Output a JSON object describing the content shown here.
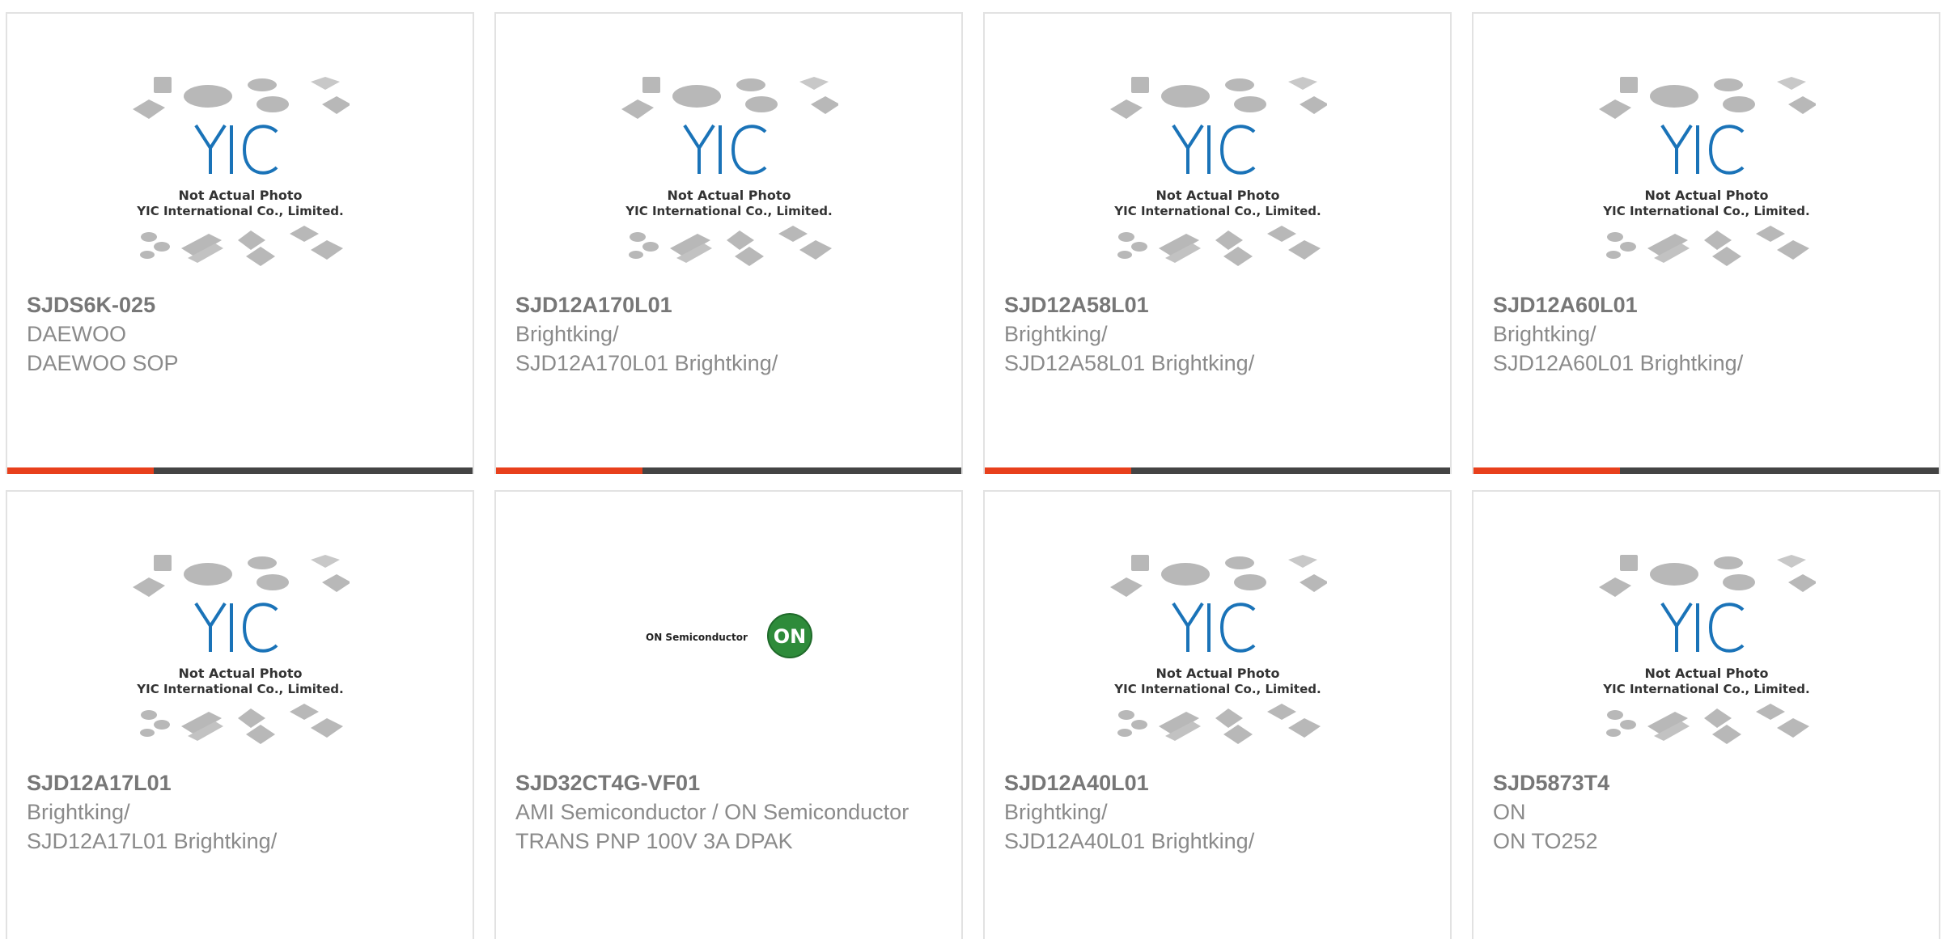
{
  "placeholder_image": {
    "caption_line1": "Not Actual Photo",
    "caption_line2": "YIC International Co., Limited.",
    "logo_text": "YIC"
  },
  "on_logo": {
    "text": "ON Semiconductor",
    "badge": "ON"
  },
  "colors": {
    "accent_red": "#e8401c",
    "accent_dark": "#444444",
    "yic_blue": "#1a73b8",
    "on_green": "#2e8b3a"
  },
  "products": [
    {
      "part_no": "SJDS6K-025",
      "manufacturer": "DAEWOO",
      "description": "DAEWOO SOP"
    },
    {
      "part_no": "SJD12A170L01",
      "manufacturer": "Brightking/",
      "description": "SJD12A170L01 Brightking/"
    },
    {
      "part_no": "SJD12A58L01",
      "manufacturer": "Brightking/",
      "description": "SJD12A58L01 Brightking/"
    },
    {
      "part_no": "SJD12A60L01",
      "manufacturer": "Brightking/",
      "description": "SJD12A60L01 Brightking/"
    },
    {
      "part_no": "SJD12A17L01",
      "manufacturer": "Brightking/",
      "description": "SJD12A17L01 Brightking/"
    },
    {
      "part_no": "SJD32CT4G-VF01",
      "manufacturer": "AMI Semiconductor / ON Semiconductor",
      "description": "TRANS PNP 100V 3A DPAK"
    },
    {
      "part_no": "SJD12A40L01",
      "manufacturer": "Brightking/",
      "description": "SJD12A40L01 Brightking/"
    },
    {
      "part_no": "SJD5873T4",
      "manufacturer": "ON",
      "description": "ON TO252"
    }
  ]
}
